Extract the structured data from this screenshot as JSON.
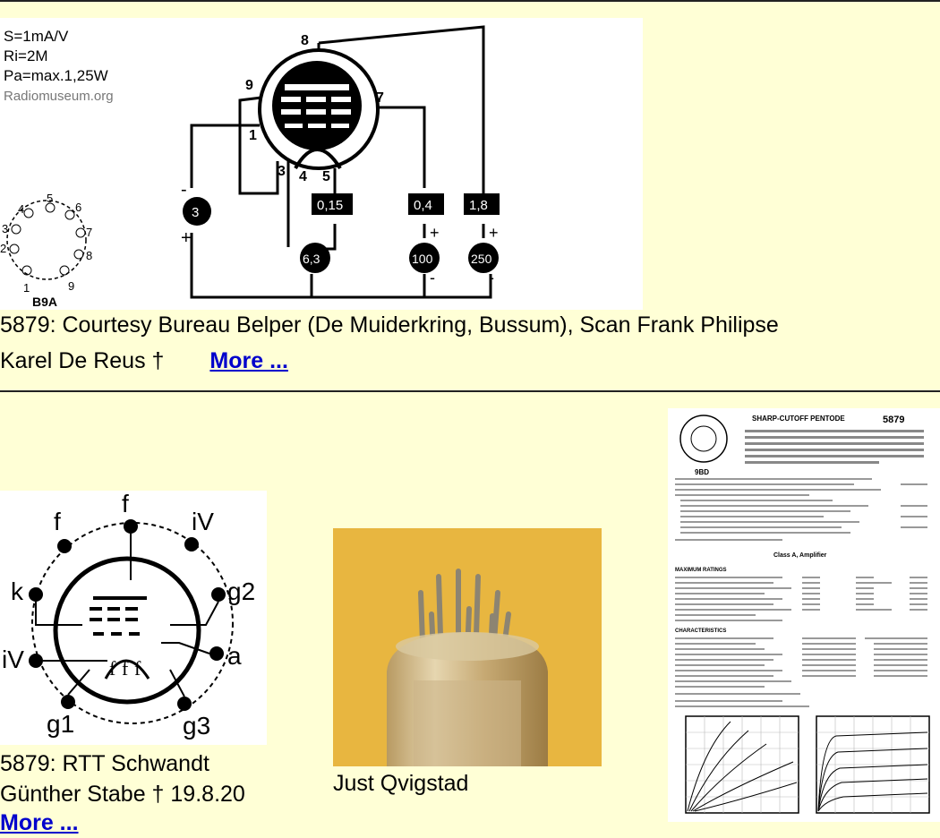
{
  "schematic": {
    "specs": [
      "S=1mA/V",
      "Ri=2M",
      "Pa=max.1,25W"
    ],
    "watermark": "Radiomuseum.org",
    "socket_label": "B9A",
    "socket_pins": [
      "1",
      "2",
      "3",
      "4",
      "5",
      "6",
      "7",
      "8",
      "9"
    ],
    "pin_labels": [
      "8",
      "9",
      "7",
      "1",
      "3",
      "4",
      "5"
    ],
    "meters": [
      "0,15",
      "0,4",
      "1,8"
    ],
    "supplies": [
      "3",
      "6,3",
      "100",
      "250"
    ],
    "signs": [
      "-",
      "+",
      "+",
      "+",
      "-",
      "-"
    ]
  },
  "entry1": {
    "caption_line1": "5879: Courtesy Bureau Belper (De Muiderkring, Bussum), Scan Frank Philipse",
    "caption_line2": "Karel De Reus †",
    "more_label": "More ..."
  },
  "entry2": {
    "pin_labels": [
      "f",
      "f",
      "iV",
      "k",
      "g2",
      "iV",
      "a",
      "g1",
      "g3"
    ],
    "inner_labels": [
      "f",
      "f",
      "f"
    ],
    "caption_line1": "5879: RTT Schwandt",
    "caption_line2": "Günther Stabe † 19.8.20",
    "more_label": "More ..."
  },
  "entry3": {
    "caption": "Just Qvigstad"
  },
  "datasheet": {
    "title": "SHARP-CUTOFF PENTODE",
    "type_number": "5879",
    "section_label": "Class A, Amplifier",
    "ratings_heading": "MAXIMUM RATINGS",
    "characteristics_heading": "CHARACTERISTICS",
    "base_label": "9BD"
  }
}
